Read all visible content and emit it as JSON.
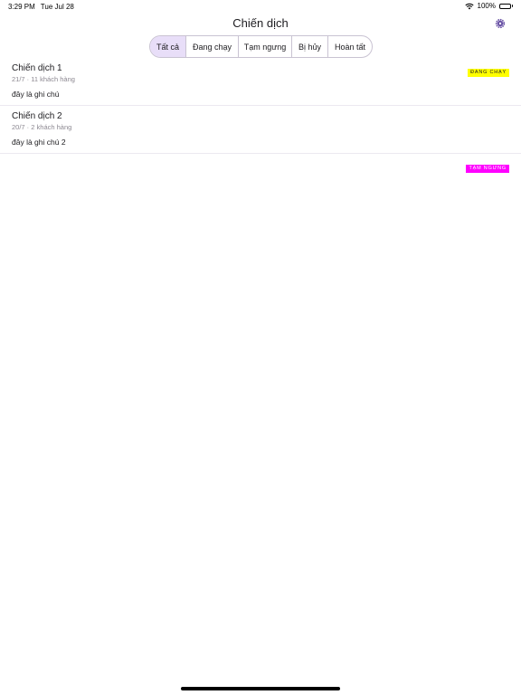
{
  "status_bar": {
    "time": "3:29 PM",
    "date": "Tue Jul 28",
    "battery": "100%"
  },
  "header": {
    "title": "Chiến dịch",
    "settings_icon": "gear-icon"
  },
  "filters": {
    "tabs": [
      {
        "label": "Tất cả",
        "selected": true
      },
      {
        "label": "Đang chạy",
        "selected": false
      },
      {
        "label": "Tạm ngưng",
        "selected": false
      },
      {
        "label": "Bị hủy",
        "selected": false
      },
      {
        "label": "Hoàn tất",
        "selected": false
      }
    ]
  },
  "campaigns": [
    {
      "name": "Chiến dịch 1",
      "meta": "21/7 · 11 khách hàng",
      "note": "đây là ghi chú",
      "status": "ĐANG CHẠY",
      "status_bg": "#ffff00",
      "status_fg": "#1c1b1f"
    },
    {
      "name": "Chiến dịch 2",
      "meta": "20/7 · 2 khách hàng",
      "note": "đây là ghi chú 2",
      "status": "TẠM NGƯNG",
      "status_bg": "#ff00ff",
      "status_fg": "#ffffff"
    }
  ],
  "colors": {
    "accent": "#6750a4",
    "selected_tab": "#e8def8",
    "divider": "#ece9f0"
  }
}
